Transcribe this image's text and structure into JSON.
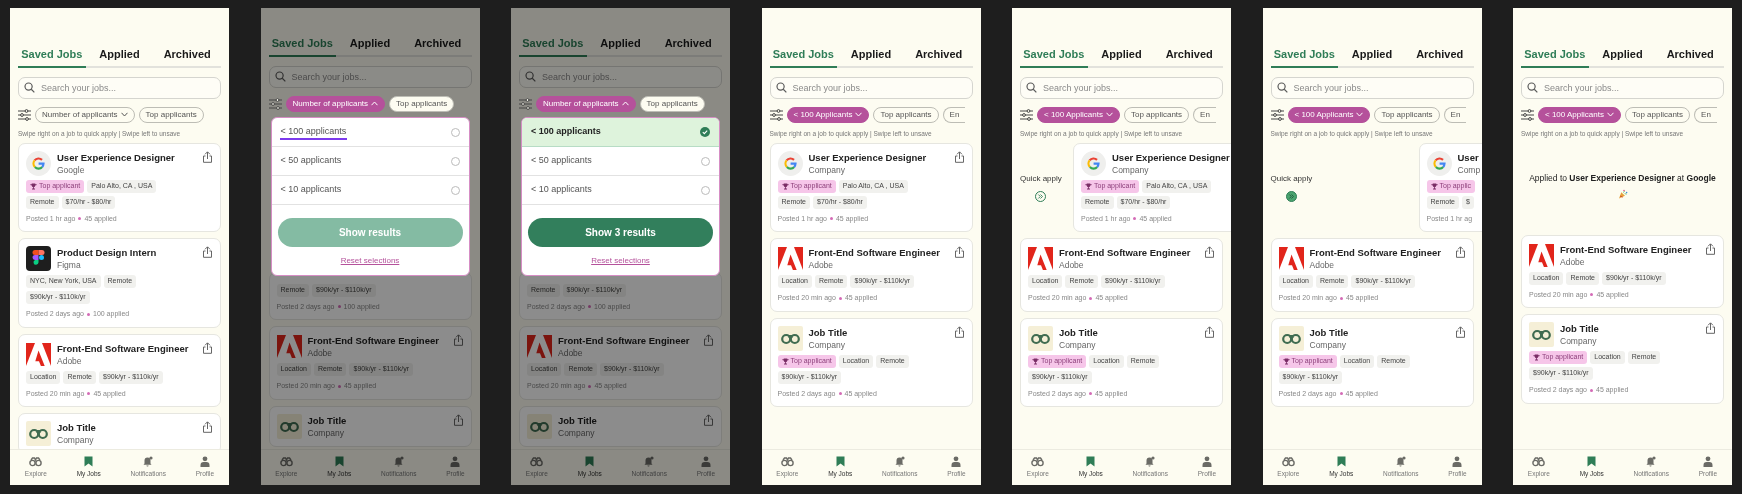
{
  "screens": [
    {
      "dimmed": false,
      "tabs": [
        {
          "label": "Saved Jobs",
          "selected": true
        },
        {
          "label": "Applied",
          "selected": false
        },
        {
          "label": "Archived",
          "selected": false
        }
      ],
      "search": {
        "placeholder": "Search your jobs..."
      },
      "filters": [
        {
          "label": "Number of applicants",
          "kind": "menu",
          "expanded": false,
          "active": false,
          "cut": false
        },
        {
          "label": "Top applicants",
          "kind": "toggle",
          "active": false,
          "cut": false
        }
      ],
      "hint": "Swipe right on a job to quick apply | Swipe left to unsave",
      "items": [
        {
          "kind": "full",
          "logo": {
            "kind": "google"
          },
          "title": "User Experience Designer",
          "company": "Google",
          "share": true,
          "tag_rows": [
            [
              {
                "label": "Top applicant",
                "kind": "top"
              },
              {
                "label": "Palo Alto, CA , USA",
                "kind": "plain"
              }
            ],
            [
              {
                "label": "Remote",
                "kind": "plain"
              },
              {
                "label": "$70/hr - $80/hr",
                "kind": "plain"
              }
            ]
          ],
          "posted": "Posted 1 hr ago",
          "applied": "45 applied"
        },
        {
          "kind": "full",
          "logo": {
            "kind": "figma"
          },
          "title": "Product Design Intern",
          "company": "Figma",
          "share": true,
          "tag_rows": [
            [
              {
                "label": "NYC, New York, USA",
                "kind": "plain"
              },
              {
                "label": "Remote",
                "kind": "plain"
              }
            ],
            [
              {
                "label": "$90k/yr - $110k/yr",
                "kind": "plain"
              }
            ]
          ],
          "posted": "Posted 2 days ago",
          "applied": "100 applied"
        },
        {
          "kind": "full",
          "logo": {
            "kind": "adobe"
          },
          "title": "Front-End Software Engineer",
          "company": "Adobe",
          "share": true,
          "tag_rows": [
            [
              {
                "label": "Location",
                "kind": "plain"
              },
              {
                "label": "Remote",
                "kind": "plain"
              },
              {
                "label": "$90k/yr - $110k/yr",
                "kind": "plain"
              }
            ]
          ],
          "posted": "Posted 20 min ago",
          "applied": "45 applied"
        },
        {
          "kind": "full",
          "logo": {
            "kind": "binoculars"
          },
          "title": "Job Title",
          "company": "Company",
          "share": true
        }
      ],
      "nav": [
        {
          "label": "Explore",
          "selected": false
        },
        {
          "label": "My Jobs",
          "selected": true
        },
        {
          "label": "Notifications",
          "selected": false
        },
        {
          "label": "Profile",
          "selected": false
        }
      ]
    },
    {
      "dimmed": true,
      "tabs": [
        {
          "label": "Saved Jobs",
          "selected": true
        },
        {
          "label": "Applied",
          "selected": false
        },
        {
          "label": "Archived",
          "selected": false
        }
      ],
      "search": {
        "placeholder": "Search your jobs..."
      },
      "filters": [
        {
          "label": "Number of applicants",
          "kind": "menu",
          "expanded": true,
          "active": true,
          "cut": false
        },
        {
          "label": "Top applicants",
          "kind": "toggle",
          "active": false,
          "cut": false
        }
      ],
      "dropdown": {
        "options": [
          {
            "label": "< 100 applicants",
            "selected": false,
            "marked": true
          },
          {
            "label": "< 50 applicants",
            "selected": false,
            "marked": false
          },
          {
            "label": "< 10 applicants",
            "selected": false,
            "marked": false
          }
        ],
        "button": {
          "label": "Show results",
          "enabled": false
        },
        "reset": "Reset selections"
      },
      "items": [
        {
          "kind": "tail",
          "share": false,
          "tag_rows": [
            [
              {
                "label": "Remote",
                "kind": "plain"
              },
              {
                "label": "$90k/yr - $110k/yr",
                "kind": "plain"
              }
            ]
          ],
          "posted": "Posted 2 days ago",
          "applied": "100 applied"
        },
        {
          "kind": "full",
          "logo": {
            "kind": "adobe"
          },
          "title": "Front-End Software Engineer",
          "company": "Adobe",
          "share": true,
          "tag_rows": [
            [
              {
                "label": "Location",
                "kind": "plain"
              },
              {
                "label": "Remote",
                "kind": "plain"
              },
              {
                "label": "$90k/yr - $110k/yr",
                "kind": "plain"
              }
            ]
          ],
          "posted": "Posted 20 min ago",
          "applied": "45 applied"
        },
        {
          "kind": "full",
          "logo": {
            "kind": "binoculars"
          },
          "title": "Job Title",
          "company": "Company",
          "share": true
        }
      ],
      "nav": [
        {
          "label": "Explore",
          "selected": false
        },
        {
          "label": "My Jobs",
          "selected": true
        },
        {
          "label": "Notifications",
          "selected": false
        },
        {
          "label": "Profile",
          "selected": false
        }
      ]
    },
    {
      "dimmed": true,
      "tabs": [
        {
          "label": "Saved Jobs",
          "selected": true
        },
        {
          "label": "Applied",
          "selected": false
        },
        {
          "label": "Archived",
          "selected": false
        }
      ],
      "search": {
        "placeholder": "Search your jobs..."
      },
      "filters": [
        {
          "label": "Number of applicants",
          "kind": "menu",
          "expanded": true,
          "active": true,
          "cut": false
        },
        {
          "label": "Top applicants",
          "kind": "toggle",
          "active": false,
          "cut": false
        }
      ],
      "dropdown": {
        "options": [
          {
            "label": "< 100 applicants",
            "selected": true,
            "marked": false
          },
          {
            "label": "< 50 applicants",
            "selected": false,
            "marked": false
          },
          {
            "label": "< 10 applicants",
            "selected": false,
            "marked": false
          }
        ],
        "button": {
          "label": "Show 3 results",
          "enabled": true
        },
        "reset": "Reset selections"
      },
      "items": [
        {
          "kind": "tail",
          "share": false,
          "tag_rows": [
            [
              {
                "label": "Remote",
                "kind": "plain"
              },
              {
                "label": "$90k/yr - $110k/yr",
                "kind": "plain"
              }
            ]
          ],
          "posted": "Posted 2 days ago",
          "applied": "100 applied"
        },
        {
          "kind": "full",
          "logo": {
            "kind": "adobe"
          },
          "title": "Front-End Software Engineer",
          "company": "Adobe",
          "share": true,
          "tag_rows": [
            [
              {
                "label": "Location",
                "kind": "plain"
              },
              {
                "label": "Remote",
                "kind": "plain"
              },
              {
                "label": "$90k/yr - $110k/yr",
                "kind": "plain"
              }
            ]
          ],
          "posted": "Posted 20 min ago",
          "applied": "45 applied"
        },
        {
          "kind": "full",
          "logo": {
            "kind": "binoculars"
          },
          "title": "Job Title",
          "company": "Company",
          "share": true
        }
      ],
      "nav": [
        {
          "label": "Explore",
          "selected": false
        },
        {
          "label": "My Jobs",
          "selected": true
        },
        {
          "label": "Notifications",
          "selected": false
        },
        {
          "label": "Profile",
          "selected": false
        }
      ]
    },
    {
      "dimmed": false,
      "tabs": [
        {
          "label": "Saved Jobs",
          "selected": true
        },
        {
          "label": "Applied",
          "selected": false
        },
        {
          "label": "Archived",
          "selected": false
        }
      ],
      "search": {
        "placeholder": "Search your jobs..."
      },
      "filters": [
        {
          "label": "< 100 Applicants",
          "kind": "menu",
          "expanded": false,
          "active": true,
          "cut": false
        },
        {
          "label": "Top applicants",
          "kind": "toggle",
          "active": false,
          "cut": false
        },
        {
          "label": "En",
          "kind": "toggle",
          "active": false,
          "cut": true
        }
      ],
      "hint": "Swipe right on a job to quick apply | Swipe left to unsave",
      "items": [
        {
          "kind": "full",
          "logo": {
            "kind": "google"
          },
          "title": "User Experience Designer",
          "company": "Company",
          "share": true,
          "tag_rows": [
            [
              {
                "label": "Top applicant",
                "kind": "top"
              },
              {
                "label": "Palo Alto, CA , USA",
                "kind": "plain"
              }
            ],
            [
              {
                "label": "Remote",
                "kind": "plain"
              },
              {
                "label": "$70/hr - $80/hr",
                "kind": "plain"
              }
            ]
          ],
          "posted": "Posted 1 hr ago",
          "applied": "45 applied"
        },
        {
          "kind": "full",
          "logo": {
            "kind": "adobe"
          },
          "title": "Front-End Software Engineer",
          "company": "Adobe",
          "share": true,
          "tag_rows": [
            [
              {
                "label": "Location",
                "kind": "plain"
              },
              {
                "label": "Remote",
                "kind": "plain"
              },
              {
                "label": "$90k/yr - $110k/yr",
                "kind": "plain"
              }
            ]
          ],
          "posted": "Posted 20 min ago",
          "applied": "45 applied"
        },
        {
          "kind": "full",
          "logo": {
            "kind": "binoculars"
          },
          "title": "Job Title",
          "company": "Company",
          "share": true,
          "tag_rows": [
            [
              {
                "label": "Top applicant",
                "kind": "top"
              },
              {
                "label": "Location",
                "kind": "plain"
              },
              {
                "label": "Remote",
                "kind": "plain"
              }
            ],
            [
              {
                "label": "$90k/yr - $110k/yr",
                "kind": "plain"
              }
            ]
          ],
          "posted": "Posted 2 days ago",
          "applied": "45 applied"
        }
      ],
      "nav": [
        {
          "label": "Explore",
          "selected": false
        },
        {
          "label": "My Jobs",
          "selected": true
        },
        {
          "label": "Notifications",
          "selected": false
        },
        {
          "label": "Profile",
          "selected": false
        }
      ]
    },
    {
      "dimmed": false,
      "tabs": [
        {
          "label": "Saved Jobs",
          "selected": true
        },
        {
          "label": "Applied",
          "selected": false
        },
        {
          "label": "Archived",
          "selected": false
        }
      ],
      "search": {
        "placeholder": "Search your jobs..."
      },
      "filters": [
        {
          "label": "< 100 Applicants",
          "kind": "menu",
          "expanded": false,
          "active": true,
          "cut": false
        },
        {
          "label": "Top applicants",
          "kind": "toggle",
          "active": false,
          "cut": false
        },
        {
          "label": "En",
          "kind": "toggle",
          "active": false,
          "cut": true
        }
      ],
      "hint": "Swipe right on a job to quick apply | Swipe left to unsave",
      "items": [
        {
          "kind": "swiped",
          "quick_apply": {
            "label": "Quick apply",
            "active": false
          },
          "logo": {
            "kind": "google"
          },
          "title": "User Experience Designer",
          "company": "Company",
          "share": false,
          "tag_rows": [
            [
              {
                "label": "Top applicant",
                "kind": "top"
              },
              {
                "label": "Palo Alto, CA , USA",
                "kind": "plain"
              }
            ],
            [
              {
                "label": "Remote",
                "kind": "plain"
              },
              {
                "label": "$70/hr - $80/hr",
                "kind": "plain"
              }
            ]
          ],
          "posted": "Posted 1 hr ago",
          "applied": "45 applied"
        },
        {
          "kind": "full",
          "logo": {
            "kind": "adobe"
          },
          "title": "Front-End Software Engineer",
          "company": "Adobe",
          "share": true,
          "tag_rows": [
            [
              {
                "label": "Location",
                "kind": "plain"
              },
              {
                "label": "Remote",
                "kind": "plain"
              },
              {
                "label": "$90k/yr - $110k/yr",
                "kind": "plain"
              }
            ]
          ],
          "posted": "Posted 20 min ago",
          "applied": "45 applied"
        },
        {
          "kind": "full",
          "logo": {
            "kind": "binoculars"
          },
          "title": "Job Title",
          "company": "Company",
          "share": true,
          "tag_rows": [
            [
              {
                "label": "Top applicant",
                "kind": "top"
              },
              {
                "label": "Location",
                "kind": "plain"
              },
              {
                "label": "Remote",
                "kind": "plain"
              }
            ],
            [
              {
                "label": "$90k/yr - $110k/yr",
                "kind": "plain"
              }
            ]
          ],
          "posted": "Posted 2 days ago",
          "applied": "45 applied"
        }
      ],
      "nav": [
        {
          "label": "Explore",
          "selected": false
        },
        {
          "label": "My Jobs",
          "selected": true
        },
        {
          "label": "Notifications",
          "selected": false
        },
        {
          "label": "Profile",
          "selected": false
        }
      ]
    },
    {
      "dimmed": false,
      "tabs": [
        {
          "label": "Saved Jobs",
          "selected": true
        },
        {
          "label": "Applied",
          "selected": false
        },
        {
          "label": "Archived",
          "selected": false
        }
      ],
      "search": {
        "placeholder": "Search your jobs..."
      },
      "filters": [
        {
          "label": "< 100 Applicants",
          "kind": "menu",
          "expanded": false,
          "active": true,
          "cut": false
        },
        {
          "label": "Top applicants",
          "kind": "toggle",
          "active": false,
          "cut": false
        },
        {
          "label": "En",
          "kind": "toggle",
          "active": false,
          "cut": true
        }
      ],
      "hint": "Swipe right on a job to quick apply | Swipe left to unsave",
      "items": [
        {
          "kind": "swiped",
          "quick_apply": {
            "label": "Quick apply",
            "active": true
          },
          "logo": {
            "kind": "google"
          },
          "title": "User",
          "company": "Comp",
          "share": false,
          "tag_rows": [
            [
              {
                "label": "Top applic",
                "kind": "top"
              }
            ],
            [
              {
                "label": "Remote",
                "kind": "plain"
              },
              {
                "label": "$",
                "kind": "plain"
              }
            ]
          ],
          "posted": "Posted 1 hr ag"
        },
        {
          "kind": "full",
          "logo": {
            "kind": "adobe"
          },
          "title": "Front-End Software Engineer",
          "company": "Adobe",
          "share": true,
          "tag_rows": [
            [
              {
                "label": "Location",
                "kind": "plain"
              },
              {
                "label": "Remote",
                "kind": "plain"
              },
              {
                "label": "$90k/yr - $110k/yr",
                "kind": "plain"
              }
            ]
          ],
          "posted": "Posted 20 min ago",
          "applied": "45 applied"
        },
        {
          "kind": "full",
          "logo": {
            "kind": "binoculars"
          },
          "title": "Job Title",
          "company": "Company",
          "share": true,
          "tag_rows": [
            [
              {
                "label": "Top applicant",
                "kind": "top"
              },
              {
                "label": "Location",
                "kind": "plain"
              },
              {
                "label": "Remote",
                "kind": "plain"
              }
            ],
            [
              {
                "label": "$90k/yr - $110k/yr",
                "kind": "plain"
              }
            ]
          ],
          "posted": "Posted 2 days ago",
          "applied": "45 applied"
        }
      ],
      "nav": [
        {
          "label": "Explore",
          "selected": false
        },
        {
          "label": "My Jobs",
          "selected": true
        },
        {
          "label": "Notifications",
          "selected": false
        },
        {
          "label": "Profile",
          "selected": false
        }
      ]
    },
    {
      "dimmed": false,
      "tabs": [
        {
          "label": "Saved Jobs",
          "selected": true
        },
        {
          "label": "Applied",
          "selected": false
        },
        {
          "label": "Archived",
          "selected": false
        }
      ],
      "search": {
        "placeholder": "Search your jobs..."
      },
      "filters": [
        {
          "label": "< 100 Applicants",
          "kind": "menu",
          "expanded": false,
          "active": true,
          "cut": false
        },
        {
          "label": "Top applicants",
          "kind": "toggle",
          "active": false,
          "cut": false
        },
        {
          "label": "En",
          "kind": "toggle",
          "active": false,
          "cut": true
        }
      ],
      "hint": "Swipe right on a job to quick apply | Swipe left to unsave",
      "items": [
        {
          "kind": "notice",
          "text": "Applied to **User Experience Designer** at **Google**"
        },
        {
          "kind": "full",
          "logo": {
            "kind": "adobe"
          },
          "title": "Front-End Software Engineer",
          "company": "Adobe",
          "share": true,
          "tag_rows": [
            [
              {
                "label": "Location",
                "kind": "plain"
              },
              {
                "label": "Remote",
                "kind": "plain"
              },
              {
                "label": "$90k/yr - $110k/yr",
                "kind": "plain"
              }
            ]
          ],
          "posted": "Posted 20 min ago",
          "applied": "45 applied"
        },
        {
          "kind": "full",
          "logo": {
            "kind": "binoculars"
          },
          "title": "Job Title",
          "company": "Company",
          "share": true,
          "tag_rows": [
            [
              {
                "label": "Top applicant",
                "kind": "top"
              },
              {
                "label": "Location",
                "kind": "plain"
              },
              {
                "label": "Remote",
                "kind": "plain"
              }
            ],
            [
              {
                "label": "$90k/yr - $110k/yr",
                "kind": "plain"
              }
            ]
          ],
          "posted": "Posted 2 days ago",
          "applied": "45 applied"
        }
      ],
      "nav": [
        {
          "label": "Explore",
          "selected": false
        },
        {
          "label": "My Jobs",
          "selected": true
        },
        {
          "label": "Notifications",
          "selected": false
        },
        {
          "label": "Profile",
          "selected": false
        }
      ]
    }
  ]
}
